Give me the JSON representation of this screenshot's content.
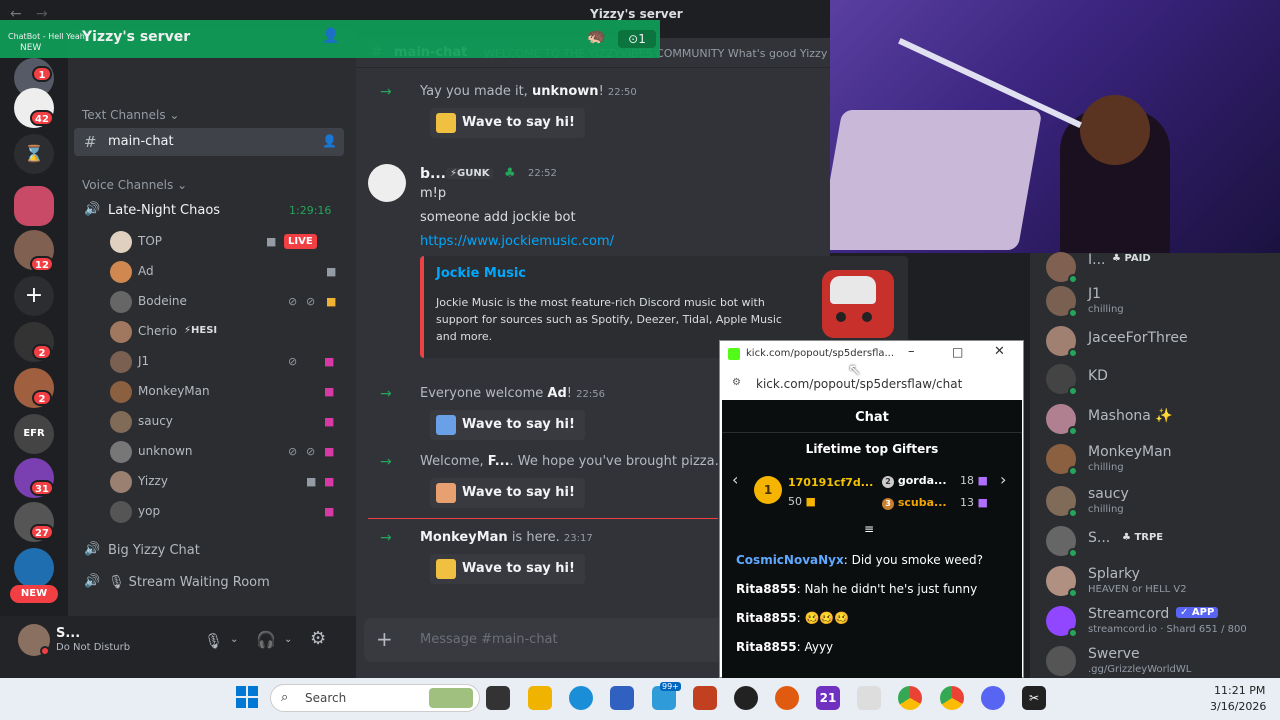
{
  "titlebar": {
    "server_title": "Yizzy's server"
  },
  "overlay": {
    "tag": "ChatBot - Hell Yeah",
    "new_label": "NEW",
    "count": "1"
  },
  "server_rail": {
    "badges": [
      "1",
      "42",
      "12",
      "2",
      "2",
      "31",
      "27"
    ],
    "efr_label": "EFR",
    "new_label": "NEW"
  },
  "sidebar": {
    "server_name": "Yizzy's server",
    "text_channels_label": "Text Channels",
    "active_channel": "main-chat",
    "voice_channels_label": "Voice Channels",
    "voice_channel": {
      "name": "Late-Night Chaos",
      "timer": "1:29:16"
    },
    "voice_users": [
      {
        "name": "TOP",
        "live": "LIVE"
      },
      {
        "name": "Ad"
      },
      {
        "name": "Bodeine"
      },
      {
        "name": "Cherio",
        "tag": "HESI"
      },
      {
        "name": "J1"
      },
      {
        "name": "MonkeyMan"
      },
      {
        "name": "saucy"
      },
      {
        "name": "unknown"
      },
      {
        "name": "Yizzy"
      },
      {
        "name": "yop"
      }
    ],
    "other_voice": [
      "Big Yizzy Chat",
      "Stream Waiting Room"
    ]
  },
  "user_panel": {
    "name": "S...",
    "status": "Do Not Disturb"
  },
  "chat": {
    "channel": "main-chat",
    "topic": "WELCOME TO THE YIZZYVIBES COMMUNITY What's good Yizzy",
    "messages": [
      {
        "pre": "Yay you made it, ",
        "user": "unknown",
        "post": "!",
        "time": "22:50",
        "wave": "Wave to say hi!"
      },
      {
        "pre": "Everyone welcome ",
        "user": "Ad",
        "post": "!",
        "time": "22:56",
        "wave": "Wave to say hi!"
      },
      {
        "pre": "Welcome, ",
        "user": "F...",
        "post": ". We hope you've brought pizza.",
        "time": "23",
        "wave": "Wave to say hi!"
      },
      {
        "pre": "",
        "user": "MonkeyMan",
        "post": " is here.",
        "time": "23:17",
        "wave": "Wave to say hi!"
      }
    ],
    "user_msg": {
      "author": "b...",
      "tag": "GUNK",
      "time": "22:52",
      "lines": [
        "m!p",
        "someone add jockie bot"
      ],
      "link": "https://www.jockiemusic.com/",
      "embed_title": "Jockie Music",
      "embed_desc": "Jockie Music is the most feature-rich Discord music bot with support for sources such as Spotify, Deezer, Tidal, Apple Music and more."
    },
    "input_placeholder": "Message #main-chat"
  },
  "members": [
    {
      "name": "I...",
      "tag": "PAID",
      "sub": ""
    },
    {
      "name": "J1",
      "sub": "chilling"
    },
    {
      "name": "JaceeForThree",
      "sub": ""
    },
    {
      "name": "KD",
      "sub": ""
    },
    {
      "name": "Mashona",
      "sub": ""
    },
    {
      "name": "MonkeyMan",
      "sub": "chilling"
    },
    {
      "name": "saucy",
      "sub": "chilling"
    },
    {
      "name": "S...",
      "tag": "TRPE",
      "sub": ""
    },
    {
      "name": "Splarky",
      "sub": "HEAVEN or HELL V2"
    },
    {
      "name": "Streamcord",
      "tag": "APP",
      "sub": "streamcord.io · Shard 651 / 800"
    },
    {
      "name": "Swerve",
      "sub": ".gg/GrizzleyWorldWL"
    }
  ],
  "popup": {
    "title": "kick.com/popout/sp5dersfla...",
    "url": "kick.com/popout/sp5dersflaw/chat",
    "heading": "Chat",
    "gifters_label": "Lifetime top Gifters",
    "top_gifter": {
      "name": "170191cf7d...",
      "count": "50",
      "rank": "1"
    },
    "gifters": [
      {
        "name": "gorda...",
        "count": "18",
        "rank": "2"
      },
      {
        "name": "scuba...",
        "count": "13",
        "rank": "3"
      }
    ],
    "messages": [
      {
        "user": "CosmicNovaNyx",
        "text": "Did you smoke weed?",
        "color": "#5fa8ff"
      },
      {
        "user": "Rita8855",
        "text": "Nah he didn't he's just funny",
        "color": "#ffffff"
      },
      {
        "user": "Rita8855",
        "text": "🥴🥴🥴",
        "color": "#ffffff"
      },
      {
        "user": "Rita8855",
        "text": "Ayyy",
        "color": "#ffffff"
      }
    ]
  },
  "taskbar": {
    "search_label": "Search",
    "time": "11:21 PM",
    "date": "3/16/2026",
    "badge": "99+",
    "num_icon": "21"
  }
}
